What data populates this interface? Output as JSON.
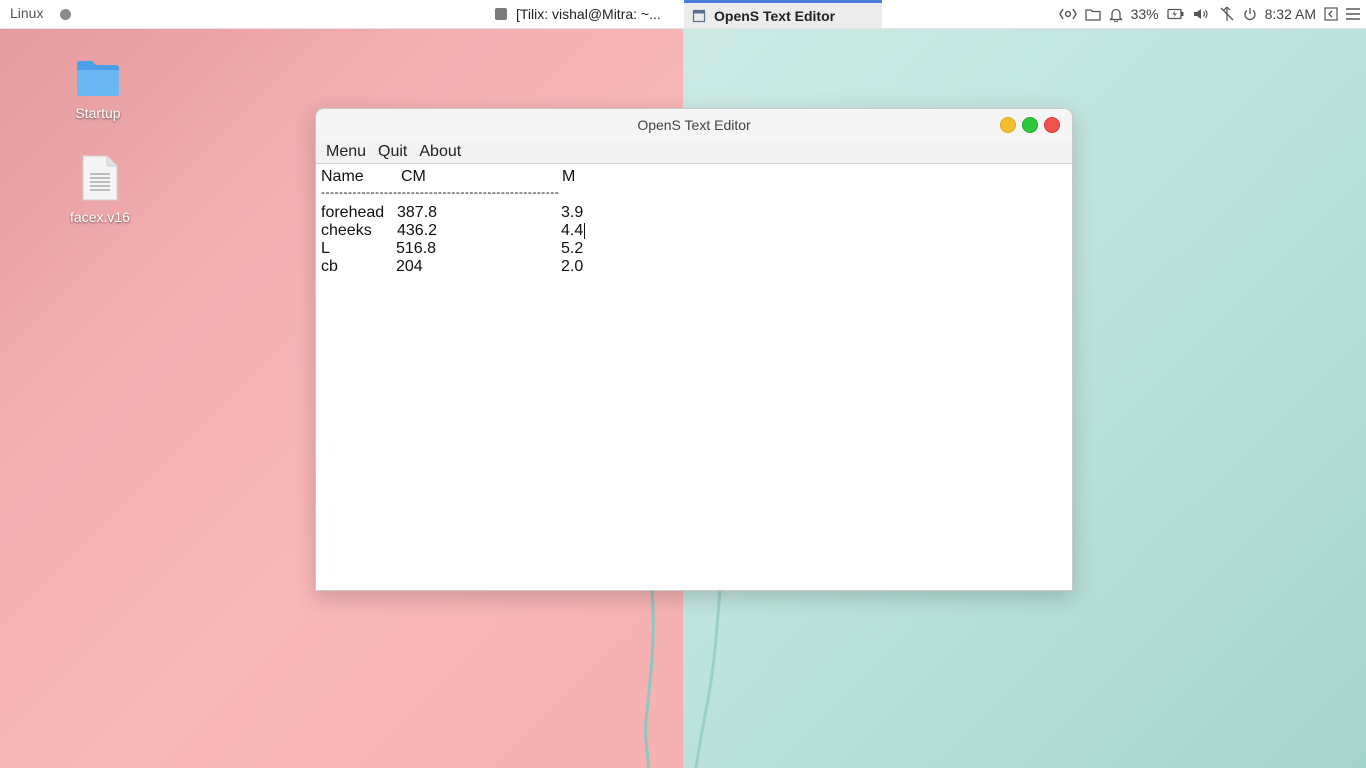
{
  "panel": {
    "os_label": "Linux",
    "tasks": [
      {
        "label": "[Tilix: vishal@Mitra: ~...",
        "icon": "terminal-icon"
      },
      {
        "label": "OpenS Text Editor",
        "icon": "window-icon"
      }
    ],
    "tray": {
      "battery": "33%",
      "clock": "8:32 AM"
    }
  },
  "desktop": {
    "icons": [
      {
        "label": "Startup",
        "icon": "folder-icon"
      },
      {
        "label": "facex.v16",
        "icon": "text-file-icon"
      }
    ]
  },
  "window": {
    "title": "OpenS Text Editor",
    "menu": [
      "Menu",
      "Quit",
      "About"
    ],
    "editor": {
      "header": {
        "name": "Name",
        "cm": "CM",
        "m": "M"
      },
      "separator": "-----------------------------------------------------",
      "rows": [
        {
          "name": "forehead",
          "cm": "387.8",
          "m": "3.9"
        },
        {
          "name": "cheeks",
          "cm": "436.2",
          "m": "4.4"
        },
        {
          "name": "L",
          "cm": "516.8",
          "m": "5.2"
        },
        {
          "name": "cb",
          "cm": "204",
          "m": "2.0"
        }
      ]
    }
  },
  "colors": {
    "wallpaper_left": "#f4b0b1",
    "wallpaper_right": "#bfe3dd",
    "active_task_accent": "#4a7dd8",
    "btn_minimize": "#f5be2e",
    "btn_maximize": "#2ec73d",
    "btn_close": "#f0524c"
  }
}
